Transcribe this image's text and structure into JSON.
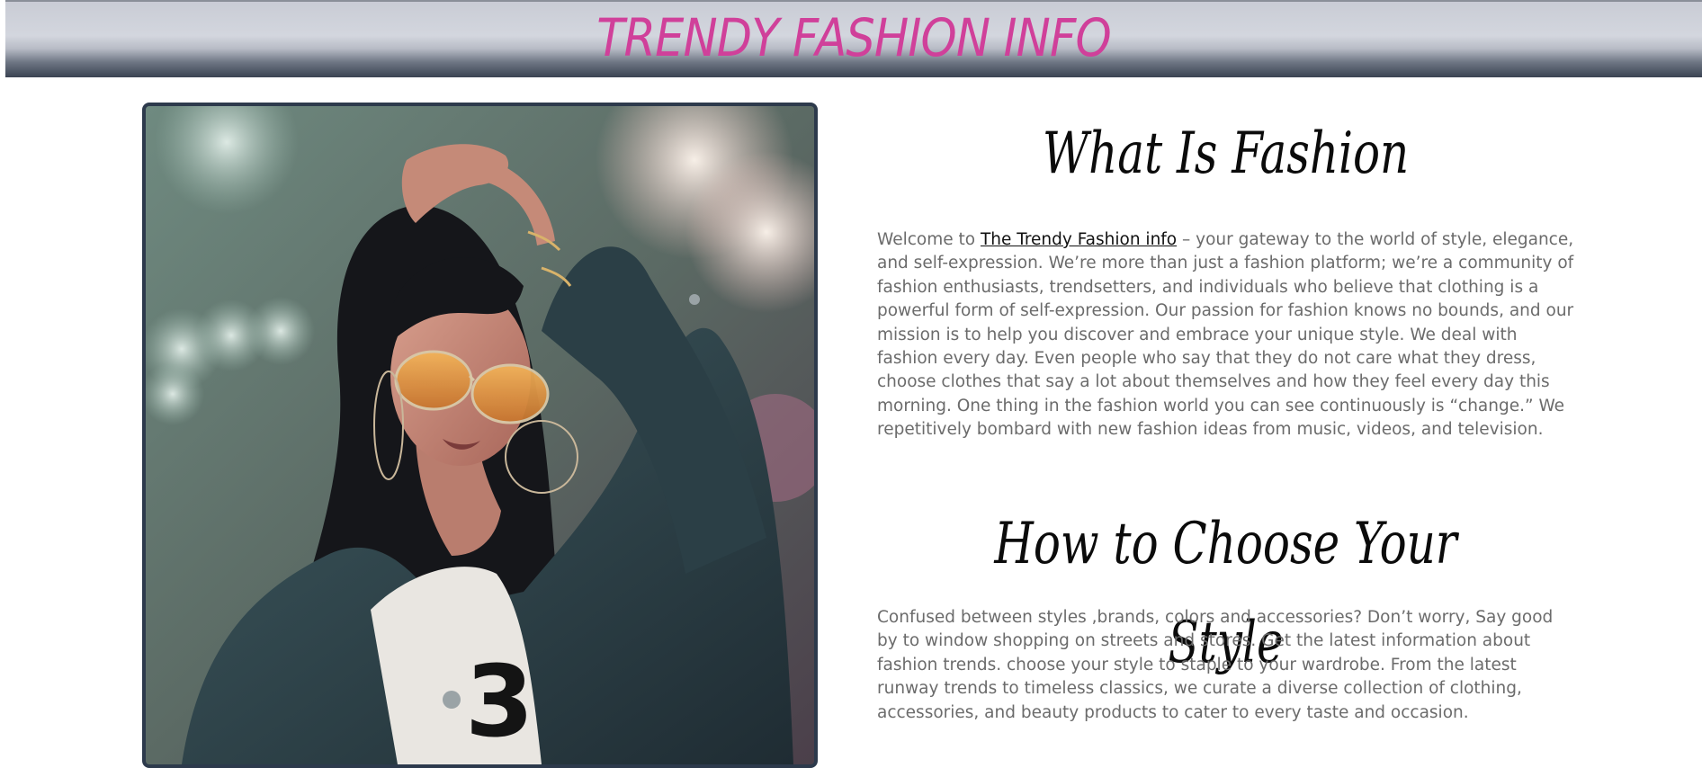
{
  "header": {
    "title": "TRENDY FASHION INFO",
    "title_color": "#d0409a"
  },
  "hero_image": {
    "alt": "woman-in-denim-jacket-with-sunglasses-photo"
  },
  "sections": [
    {
      "heading": "What Is Fashion",
      "paragraph_before_link": "Welcome to ",
      "link_text": "The Trendy Fashion info",
      "paragraph_after_link": " – your gateway to the world of style, elegance, and self-expression. We’re more than just a fashion platform; we’re a community of fashion enthusiasts, trendsetters, and individuals who believe that clothing is a powerful form of self-expression. Our passion for fashion knows no bounds, and our mission is to help you discover and embrace your unique style. We deal with fashion every day. Even people who say that they do not care what they dress, choose clothes that say a lot about themselves and how they feel every day this morning. One thing in the fashion world you can see continuously is “change.” We repetitively bombard with new fashion ideas from music, videos, and television."
    },
    {
      "heading": "How to Choose Your Style",
      "paragraph": "Confused between styles ,brands, colors and accessories? Don’t worry, Say good by to window shopping on streets and stores. Get the latest information about fashion trends. choose your style to staple to your wardrobe. From the latest runway trends to timeless classics, we curate a diverse collection of clothing, accessories, and beauty products to cater to every taste and occasion."
    }
  ]
}
